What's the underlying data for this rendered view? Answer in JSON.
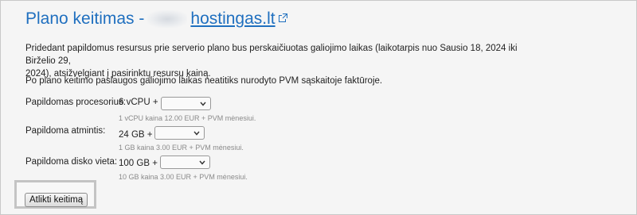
{
  "header": {
    "title_prefix": "Plano keitimas -",
    "link_text": "hostingas.lt",
    "link_icon": "external-link-icon"
  },
  "intro": {
    "line1": "Pridedant papildomus resursus prie serverio plano bus perskaičiuotas galiojimo laikas (laikotarpis nuo Sausio 18, 2024 iki Birželio 29,",
    "line2": "2024), atsižvelgiant į pasirinktų resursų kainą.",
    "note": "Po plano keitimo paslaugos galiojimo laikas neatitiks nurodyto PVM sąskaitoje faktūroje."
  },
  "form": {
    "cpu": {
      "label": "Papildomas procesorius:",
      "current": "6 vCPU +",
      "selected": "",
      "hint": "1 vCPU kaina 12.00 EUR + PVM mėnesiui."
    },
    "ram": {
      "label": "Papildoma atmintis:",
      "current": "24 GB +",
      "selected": "",
      "hint": "1 GB kaina 3.00 EUR + PVM mėnesiui."
    },
    "disk": {
      "label": "Papildoma disko vieta:",
      "current": "100 GB +",
      "selected": "",
      "hint": "10 GB kaina 3.00 EUR + PVM mėnesiui."
    }
  },
  "actions": {
    "submit_label": "Atlikti keitimą"
  },
  "colors": {
    "title": "#1f6fbf",
    "background": "#f5f5f5",
    "hint": "#8a8a8a"
  }
}
